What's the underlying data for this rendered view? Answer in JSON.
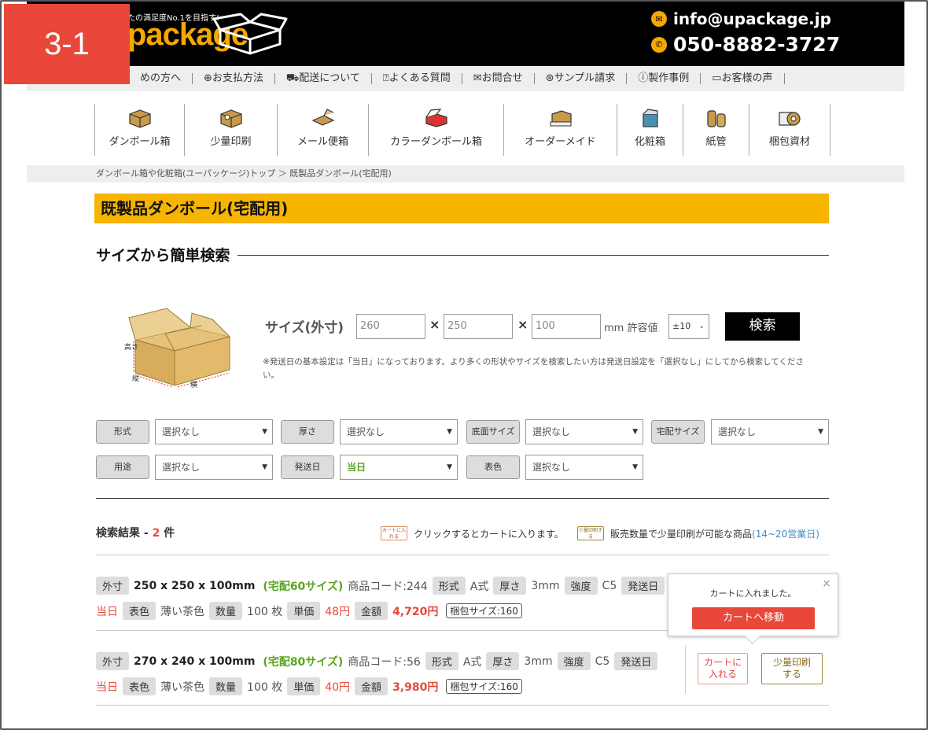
{
  "badge": "3-1",
  "header": {
    "tagline": "たの満足度No.1を目指す!",
    "logo": "package",
    "email": "info@upackage.jp",
    "phone": "050-8882-3727"
  },
  "subnav": [
    "めの方へ",
    "⊕お支払方法",
    "配送について",
    "よくある質問",
    "お問合せ",
    "サンプル請求",
    "製作事例",
    "お客様の声"
  ],
  "categories": [
    "ダンボール箱",
    "少量印刷",
    "メール便箱",
    "カラーダンボール箱",
    "オーダーメイド",
    "化粧箱",
    "紙管",
    "梱包資材"
  ],
  "breadcrumb": "ダンボール箱や化粧箱(ユーパッケージ)トップ ＞ 既製品ダンボール(宅配用)",
  "page_title": "既製品ダンボール(宅配用)",
  "section_title": "サイズから簡単検索",
  "search": {
    "size_label": "サイズ(外寸)",
    "w": "260",
    "d": "250",
    "h": "100",
    "times": "×",
    "unit_label": "mm 許容値",
    "tolerance": "±10",
    "button": "検索",
    "note": "※発送日の基本設定は「当日」になっております。より多くの形状やサイズを検索したい方は発送日設定を「選択なし」にしてから検索してください。",
    "box_labels": {
      "height": "高さ",
      "depth": "縦",
      "width": "横"
    }
  },
  "filters": {
    "f1": {
      "label": "形式",
      "value": "選択なし"
    },
    "f2": {
      "label": "厚さ",
      "value": "選択なし"
    },
    "f3": {
      "label": "底面サイズ",
      "value": "選択なし"
    },
    "f4": {
      "label": "宅配サイズ",
      "value": "選択なし"
    },
    "f5": {
      "label": "用途",
      "value": "選択なし"
    },
    "f6": {
      "label": "発送日",
      "value": "当日"
    },
    "f7": {
      "label": "表色",
      "value": "選択なし"
    }
  },
  "results": {
    "prefix": "検索結果 - ",
    "count": "2",
    "suffix": " 件",
    "legend_cart_icon": "カートに入れる",
    "legend_cart_text": "クリックするとカートに入ります。",
    "legend_print_icon": "少量印刷する",
    "legend_print_text": "販売数量で少量印刷が可能な商品",
    "legend_days": "(14~20営業日)"
  },
  "products": [
    {
      "outer_label": "外寸",
      "size": "250 x 250 x 100mm",
      "delivery": "(宅配60サイズ)",
      "code": "商品コード:244",
      "type_label": "形式",
      "type": "A式",
      "thick_label": "厚さ",
      "thick": "3mm",
      "strength_label": "強度",
      "strength": "C5",
      "ship_label": "発送日",
      "ship": "当日",
      "color_label": "表色",
      "color": "薄い茶色",
      "qty_label": "数量",
      "qty": "100 枚",
      "unit_label": "単価",
      "unit": "48円",
      "total_label": "金額",
      "total": "4,720円",
      "pack": "梱包サイズ:160"
    },
    {
      "outer_label": "外寸",
      "size": "270 x 240 x 100mm",
      "delivery": "(宅配80サイズ)",
      "code": "商品コード:56",
      "type_label": "形式",
      "type": "A式",
      "thick_label": "厚さ",
      "thick": "3mm",
      "strength_label": "強度",
      "strength": "C5",
      "ship_label": "発送日",
      "ship": "当日",
      "color_label": "表色",
      "color": "薄い茶色",
      "qty_label": "数量",
      "qty": "100 枚",
      "unit_label": "単価",
      "unit": "40円",
      "total_label": "金額",
      "total": "3,980円",
      "pack": "梱包サイズ:160",
      "cart_button": "カートに入れる",
      "print_button": "少量印刷する"
    }
  ],
  "popup": {
    "message": "カートに入れました。",
    "button": "カートへ移動",
    "close": "×"
  }
}
